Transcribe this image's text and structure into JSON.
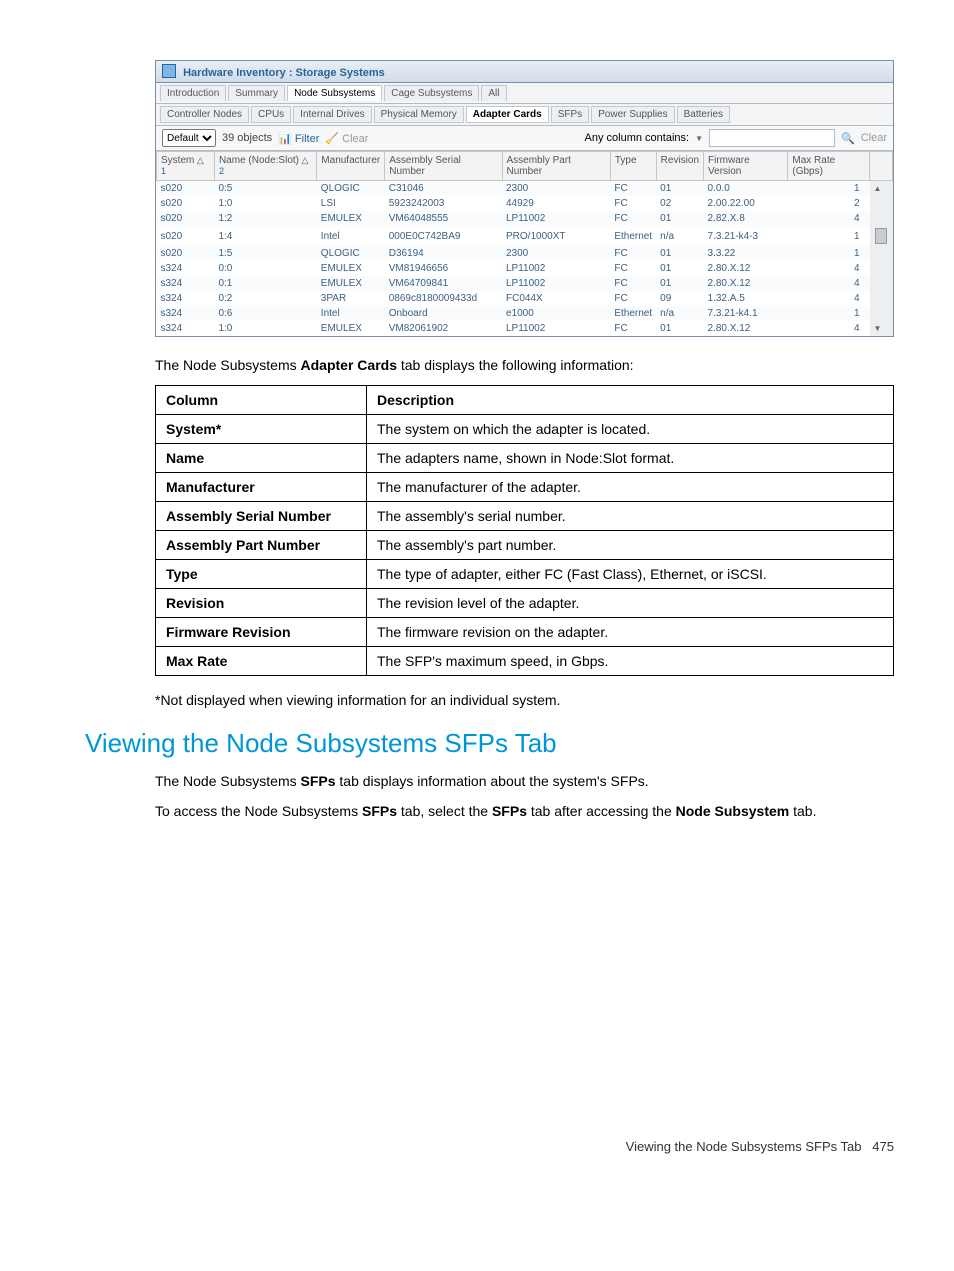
{
  "window": {
    "title": "Hardware Inventory : Storage Systems",
    "tabs": [
      "Introduction",
      "Summary",
      "Node Subsystems",
      "Cage Subsystems",
      "All"
    ],
    "activeTab": "Node Subsystems",
    "subtabs": [
      "Controller Nodes",
      "CPUs",
      "Internal Drives",
      "Physical Memory",
      "Adapter Cards",
      "SFPs",
      "Power Supplies",
      "Batteries"
    ],
    "activeSubtab": "Adapter Cards",
    "toolbar": {
      "viewSelected": "Default",
      "objects": "39 objects",
      "filter": "Filter",
      "clearBtn": "Clear",
      "anyColumn": "Any column contains:",
      "clearSearch": "Clear"
    },
    "columns": [
      {
        "label": "System",
        "sort": "△ 1"
      },
      {
        "label": "Name (Node:Slot)",
        "sort": "△ 2"
      },
      {
        "label": "Manufacturer"
      },
      {
        "label": "Assembly Serial Number"
      },
      {
        "label": "Assembly Part Number"
      },
      {
        "label": "Type"
      },
      {
        "label": "Revision"
      },
      {
        "label": "Firmware Version"
      },
      {
        "label": "Max Rate (Gbps)"
      }
    ],
    "rows": [
      {
        "c": [
          "s020",
          "0:5",
          "QLOGIC",
          "C31046",
          "2300",
          "FC",
          "01",
          "0.0.0",
          "1"
        ]
      },
      {
        "c": [
          "s020",
          "1:0",
          "LSI",
          "5923242003",
          "44929",
          "FC",
          "02",
          "2.00.22.00",
          "2"
        ]
      },
      {
        "c": [
          "s020",
          "1:2",
          "EMULEX",
          "VM64048555",
          "LP11002",
          "FC",
          "01",
          "2.82.X.8",
          "4"
        ]
      },
      {
        "c": [
          "s020",
          "1:4",
          "Intel",
          "000E0C742BA9",
          "PRO/1000XT",
          "Ethernet",
          "n/a",
          "7.3.21-k4-3",
          "1"
        ]
      },
      {
        "c": [
          "s020",
          "1:5",
          "QLOGIC",
          "D36194",
          "2300",
          "FC",
          "01",
          "3.3.22",
          "1"
        ]
      },
      {
        "c": [
          "s324",
          "0:0",
          "EMULEX",
          "VM81946656",
          "LP11002",
          "FC",
          "01",
          "2.80.X.12",
          "4"
        ]
      },
      {
        "c": [
          "s324",
          "0:1",
          "EMULEX",
          "VM64709841",
          "LP11002",
          "FC",
          "01",
          "2.80.X.12",
          "4"
        ]
      },
      {
        "c": [
          "s324",
          "0:2",
          "3PAR",
          "0869c8180009433d",
          "FC044X",
          "FC",
          "09",
          "1.32.A.5",
          "4"
        ]
      },
      {
        "c": [
          "s324",
          "0:6",
          "Intel",
          "Onboard",
          "e1000",
          "Ethernet",
          "n/a",
          "7.3.21-k4.1",
          "1"
        ]
      },
      {
        "c": [
          "s324",
          "1:0",
          "EMULEX",
          "VM82061902",
          "LP11002",
          "FC",
          "01",
          "2.80.X.12",
          "4"
        ]
      }
    ]
  },
  "introText": {
    "pre": "The Node Subsystems ",
    "bold": "Adapter Cards",
    "post": " tab displays the following information:"
  },
  "descTable": {
    "headers": [
      "Column",
      "Description"
    ],
    "rows": [
      [
        "System*",
        "The system on which the adapter is located."
      ],
      [
        "Name",
        "The adapters name, shown in Node:Slot format."
      ],
      [
        "Manufacturer",
        "The manufacturer of the adapter."
      ],
      [
        "Assembly Serial Number",
        "The assembly's serial number."
      ],
      [
        "Assembly Part Number",
        "The assembly's part number."
      ],
      [
        "Type",
        "The type of adapter, either FC (Fast Class), Ethernet, or iSCSI."
      ],
      [
        "Revision",
        "The revision level of the adapter."
      ],
      [
        "Firmware Revision",
        "The firmware revision on the adapter."
      ],
      [
        "Max Rate",
        "The SFP's maximum speed, in Gbps."
      ]
    ]
  },
  "footNote": "*Not displayed when viewing information for an individual system.",
  "section": {
    "heading": "Viewing the Node Subsystems SFPs Tab",
    "p1": {
      "pre": "The Node Subsystems ",
      "b1": "SFPs",
      "post": " tab displays information about the system's SFPs."
    },
    "p2": {
      "t1": "To access the Node Subsystems ",
      "b1": "SFPs",
      "t2": " tab, select the ",
      "b2": "SFPs",
      "t3": " tab after accessing the ",
      "b3": "Node Subsystem",
      "t4": " tab."
    }
  },
  "pageFooter": {
    "label": "Viewing the Node Subsystems SFPs Tab",
    "page": "475"
  }
}
